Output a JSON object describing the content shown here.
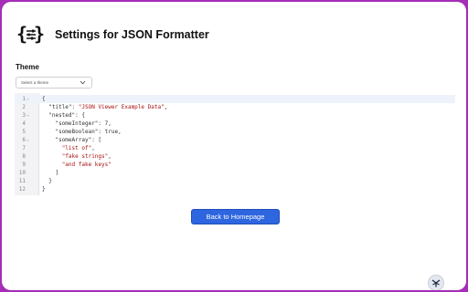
{
  "header": {
    "title": "Settings for JSON Formatter",
    "logo_icon": "json-settings-icon"
  },
  "theme": {
    "label": "Theme",
    "select_placeholder": "Select a theme"
  },
  "editor": {
    "lines": [
      {
        "n": "1",
        "fold": true,
        "tokens": [
          {
            "t": "p",
            "v": "{"
          }
        ]
      },
      {
        "n": "2",
        "fold": false,
        "tokens": [
          {
            "t": "p",
            "v": "  "
          },
          {
            "t": "k",
            "v": "\"title\""
          },
          {
            "t": "p",
            "v": ": "
          },
          {
            "t": "s",
            "v": "\"JSON Viewer Example Data\""
          },
          {
            "t": "p",
            "v": ","
          }
        ]
      },
      {
        "n": "3",
        "fold": true,
        "tokens": [
          {
            "t": "p",
            "v": "  "
          },
          {
            "t": "k",
            "v": "\"nested\""
          },
          {
            "t": "p",
            "v": ": {"
          }
        ]
      },
      {
        "n": "4",
        "fold": false,
        "tokens": [
          {
            "t": "p",
            "v": "    "
          },
          {
            "t": "k",
            "v": "\"someInteger\""
          },
          {
            "t": "p",
            "v": ": 7,"
          }
        ]
      },
      {
        "n": "5",
        "fold": false,
        "tokens": [
          {
            "t": "p",
            "v": "    "
          },
          {
            "t": "k",
            "v": "\"someBoolean\""
          },
          {
            "t": "p",
            "v": ": true,"
          }
        ]
      },
      {
        "n": "6",
        "fold": true,
        "tokens": [
          {
            "t": "p",
            "v": "    "
          },
          {
            "t": "k",
            "v": "\"someArray\""
          },
          {
            "t": "p",
            "v": ": ["
          }
        ]
      },
      {
        "n": "7",
        "fold": false,
        "tokens": [
          {
            "t": "p",
            "v": "      "
          },
          {
            "t": "s",
            "v": "\"list of\""
          },
          {
            "t": "p",
            "v": ","
          }
        ]
      },
      {
        "n": "8",
        "fold": false,
        "tokens": [
          {
            "t": "p",
            "v": "      "
          },
          {
            "t": "s",
            "v": "\"fake strings\""
          },
          {
            "t": "p",
            "v": ","
          }
        ]
      },
      {
        "n": "9",
        "fold": false,
        "tokens": [
          {
            "t": "p",
            "v": "      "
          },
          {
            "t": "s",
            "v": "\"and fake keys\""
          }
        ]
      },
      {
        "n": "10",
        "fold": false,
        "tokens": [
          {
            "t": "p",
            "v": "    ]"
          }
        ]
      },
      {
        "n": "11",
        "fold": false,
        "tokens": [
          {
            "t": "p",
            "v": "  }"
          }
        ]
      },
      {
        "n": "12",
        "fold": false,
        "tokens": [
          {
            "t": "p",
            "v": "}"
          }
        ]
      }
    ]
  },
  "actions": {
    "back_label": "Back to Homepage"
  },
  "colors": {
    "frame": "#a52db8",
    "button": "#2e66e0",
    "string": "#aa1111"
  },
  "corner_icon": "extension-badge-icon"
}
